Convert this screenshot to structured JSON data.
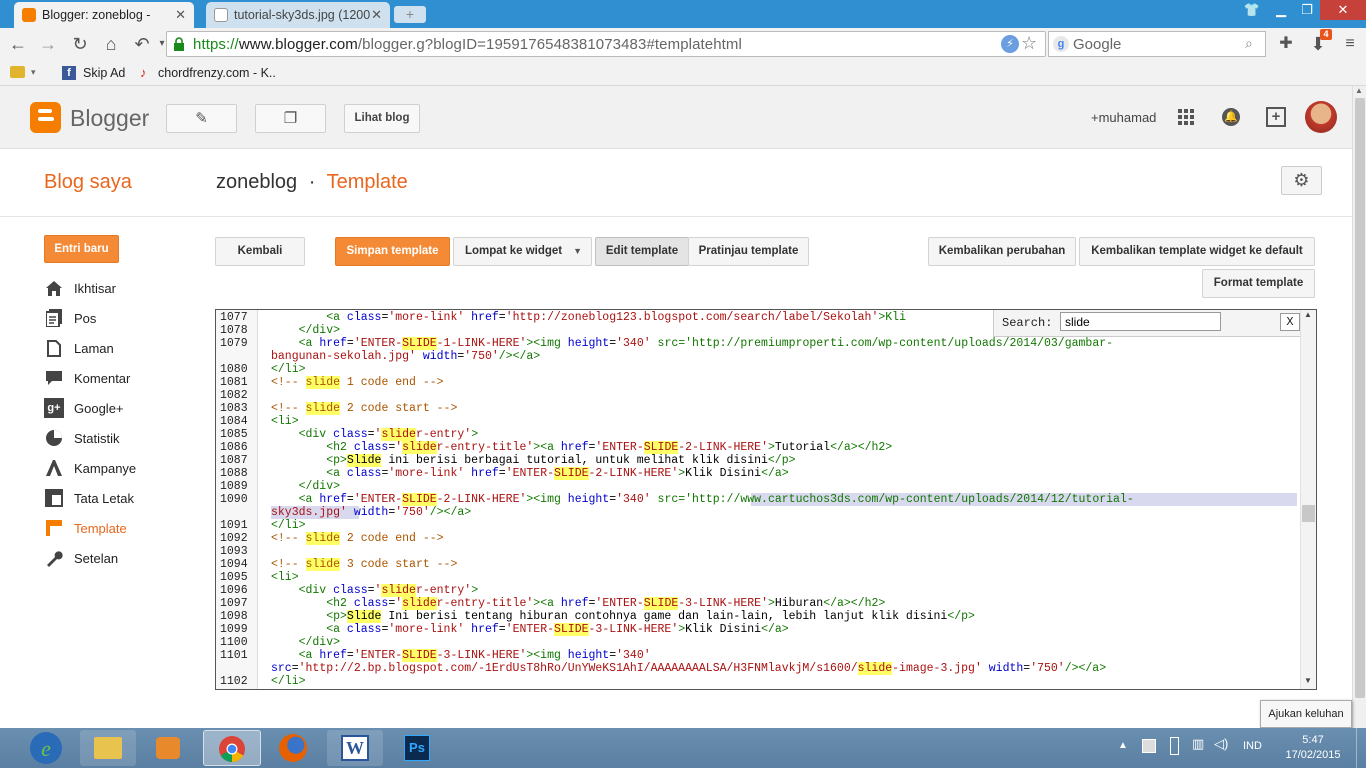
{
  "browser": {
    "tabs": [
      {
        "title": "Blogger: zoneblog -",
        "active": true
      },
      {
        "title": "tutorial-sky3ds.jpg (1200",
        "active": false
      }
    ],
    "url": {
      "scheme": "https://",
      "host": "www.blogger.com",
      "path": "/blogger.g?blogID=1959176548381073483#templatehtml"
    },
    "search_placeholder": "Google",
    "extension_badge": "4",
    "bookmarks": [
      {
        "label": "Skip Ad",
        "icon": "facebook-icon"
      },
      {
        "label": "chordfrenzy.com - K..",
        "icon": "chordfrenzy-icon"
      }
    ]
  },
  "blogger_bar": {
    "logo_text": "Blogger",
    "view_blog_label": "Lihat blog",
    "user_name": "+muhamad"
  },
  "page_header": {
    "my_blogs": "Blog saya",
    "blog_name": "zoneblog",
    "separator": "·",
    "section": "Template"
  },
  "sidebar": {
    "new_post_label": "Entri baru",
    "items": [
      {
        "label": "Ikhtisar",
        "icon": "home-icon",
        "active": false
      },
      {
        "label": "Pos",
        "icon": "posts-icon",
        "active": false
      },
      {
        "label": "Laman",
        "icon": "pages-icon",
        "active": false
      },
      {
        "label": "Komentar",
        "icon": "comment-icon",
        "active": false
      },
      {
        "label": "Google+",
        "icon": "google-plus-icon",
        "active": false
      },
      {
        "label": "Statistik",
        "icon": "stats-icon",
        "active": false
      },
      {
        "label": "Kampanye",
        "icon": "campaign-icon",
        "active": false
      },
      {
        "label": "Tata Letak",
        "icon": "layout-icon",
        "active": false
      },
      {
        "label": "Template",
        "icon": "template-icon",
        "active": true
      },
      {
        "label": "Setelan",
        "icon": "wrench-icon",
        "active": false
      }
    ]
  },
  "editor_toolbar": {
    "back": "Kembali",
    "save": "Simpan template",
    "jump": "Lompat ke widget",
    "edit": "Edit template",
    "preview": "Pratinjau template",
    "revert": "Kembalikan perubahan",
    "revert_widgets": "Kembalikan template widget ke default",
    "format": "Format template"
  },
  "search_panel": {
    "label": "Search:",
    "value": "slide",
    "close": "X"
  },
  "code_lines": [
    {
      "n": "1077",
      "code": "        <a class='more-link' href='http://zoneblog123.blogspot.com/search/label/Sekolah'>Kli"
    },
    {
      "n": "1078",
      "code": "    </div>"
    },
    {
      "n": "1079",
      "code": "    <a href='ENTER-SLIDE-1-LINK-HERE'><img height='340' src='http://premiumproperti.com/wp-content/uploads/2014/03/gambar-"
    },
    {
      "n": "",
      "code": "bangunan-sekolah.jpg' width='750'/></a>"
    },
    {
      "n": "1080",
      "code": "</li>"
    },
    {
      "n": "1081",
      "code": "<!-- slide 1 code end -->"
    },
    {
      "n": "1082",
      "code": ""
    },
    {
      "n": "1083",
      "code": "<!-- slide 2 code start -->"
    },
    {
      "n": "1084",
      "code": "<li>"
    },
    {
      "n": "1085",
      "code": "    <div class='slider-entry'>"
    },
    {
      "n": "1086",
      "code": "        <h2 class='slider-entry-title'><a href='ENTER-SLIDE-2-LINK-HERE'>Tutorial</a></h2>"
    },
    {
      "n": "1087",
      "code": "        <p>Slide ini berisi berbagai tutorial, untuk melihat klik disini</p>"
    },
    {
      "n": "1088",
      "code": "        <a class='more-link' href='ENTER-SLIDE-2-LINK-HERE'>Klik Disini</a>"
    },
    {
      "n": "1089",
      "code": "    </div>"
    },
    {
      "n": "1090",
      "code": "    <a href='ENTER-SLIDE-2-LINK-HERE'><img height='340' src='http://www.cartuchos3ds.com/wp-content/uploads/2014/12/tutorial-"
    },
    {
      "n": "",
      "code": "sky3ds.jpg' width='750'/></a>"
    },
    {
      "n": "1091",
      "code": "</li>"
    },
    {
      "n": "1092",
      "code": "<!-- slide 2 code end -->"
    },
    {
      "n": "1093",
      "code": ""
    },
    {
      "n": "1094",
      "code": "<!-- slide 3 code start -->"
    },
    {
      "n": "1095",
      "code": "<li>"
    },
    {
      "n": "1096",
      "code": "    <div class='slider-entry'>"
    },
    {
      "n": "1097",
      "code": "        <h2 class='slider-entry-title'><a href='ENTER-SLIDE-3-LINK-HERE'>Hiburan</a></h2>"
    },
    {
      "n": "1098",
      "code": "        <p>Slide Ini berisi tentang hiburan contohnya game dan lain-lain, lebih lanjut klik disini</p>"
    },
    {
      "n": "1099",
      "code": "        <a class='more-link' href='ENTER-SLIDE-3-LINK-HERE'>Klik Disini</a>"
    },
    {
      "n": "1100",
      "code": "    </div>"
    },
    {
      "n": "1101",
      "code": "    <a href='ENTER-SLIDE-3-LINK-HERE'><img height='340'"
    },
    {
      "n": "",
      "code": "src='http://2.bp.blogspot.com/-1ErdUsT8hRo/UnYWeKS1AhI/AAAAAAAALSA/H3FNMlavkjM/s1600/slide-image-3.jpg' width='750'/></a>"
    },
    {
      "n": "1102",
      "code": "</li>"
    }
  ],
  "taskbar": {
    "tooltip": "Ajukan keluhan",
    "language": "IND",
    "time": "5:47",
    "date": "17/02/2015"
  }
}
